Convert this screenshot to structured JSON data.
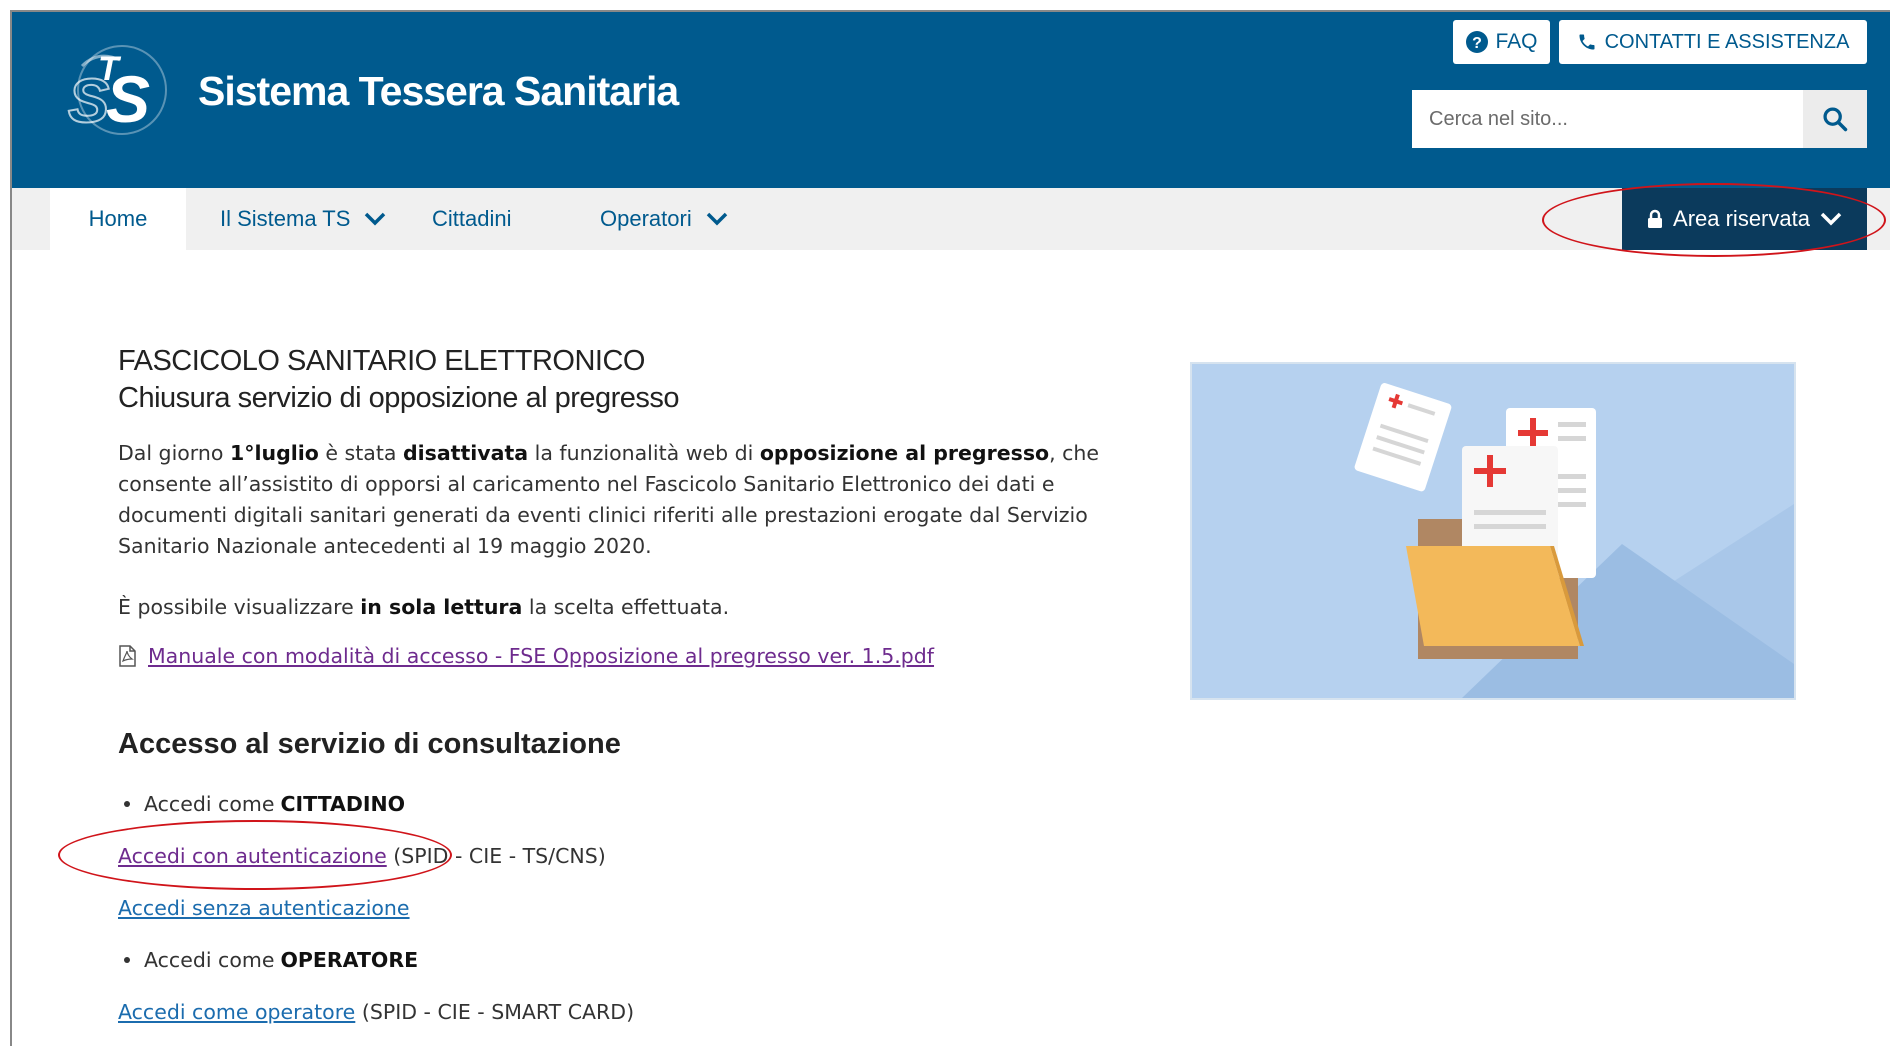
{
  "header": {
    "title": "Sistema Tessera Sanitaria",
    "faq_label": "FAQ",
    "contact_label": "CONTATTI E ASSISTENZA",
    "search_placeholder": "Cerca nel sito..."
  },
  "nav": {
    "items": [
      {
        "label": "Home"
      },
      {
        "label": "Il Sistema TS"
      },
      {
        "label": "Cittadini"
      },
      {
        "label": "Operatori"
      }
    ],
    "area_riservata": "Area riservata"
  },
  "main": {
    "title": "FASCICOLO SANITARIO ELETTRONICO",
    "subtitle": "Chiusura servizio di opposizione al pregresso",
    "para1": {
      "t1": "Dal giorno ",
      "b1": "1°luglio",
      "t2": " è stata ",
      "b2": "disattivata",
      "t3": " la funzionalità web di ",
      "b3": "opposizione al pregresso",
      "t4": ", che consente all’assistito di opporsi al caricamento nel Fascicolo Sanitario Elettronico dei dati e documenti digitali sanitari generati da eventi clinici riferiti alle prestazioni erogate dal Servizio Sanitario Nazionale antecedenti al 19 maggio 2020."
    },
    "para2": {
      "t1": "È possibile visualizzare ",
      "b1": "in sola lettura",
      "t2": " la scelta effettuata."
    },
    "manual_link": "Manuale con modalità di accesso - FSE Opposizione al pregresso ver. 1.5.pdf",
    "section_title": "Accesso al servizio di consultazione",
    "citizen": {
      "prefix": "Accedi come",
      "role": "CITTADINO",
      "auth_link": "Accedi con autenticazione",
      "auth_suffix": "(SPID - CIE - TS/CNS)",
      "noauth_link": "Accedi senza autenticazione"
    },
    "operator": {
      "prefix": "Accedi come",
      "role": "OPERATORE",
      "link": "Accedi come operatore",
      "suffix": "(SPID - CIE - SMART CARD)"
    }
  },
  "colors": {
    "brand_blue": "#005a8e",
    "dark_navy": "#0b3a5c",
    "nav_bg": "#f0f0f0",
    "annotation_red": "#d0141a"
  }
}
